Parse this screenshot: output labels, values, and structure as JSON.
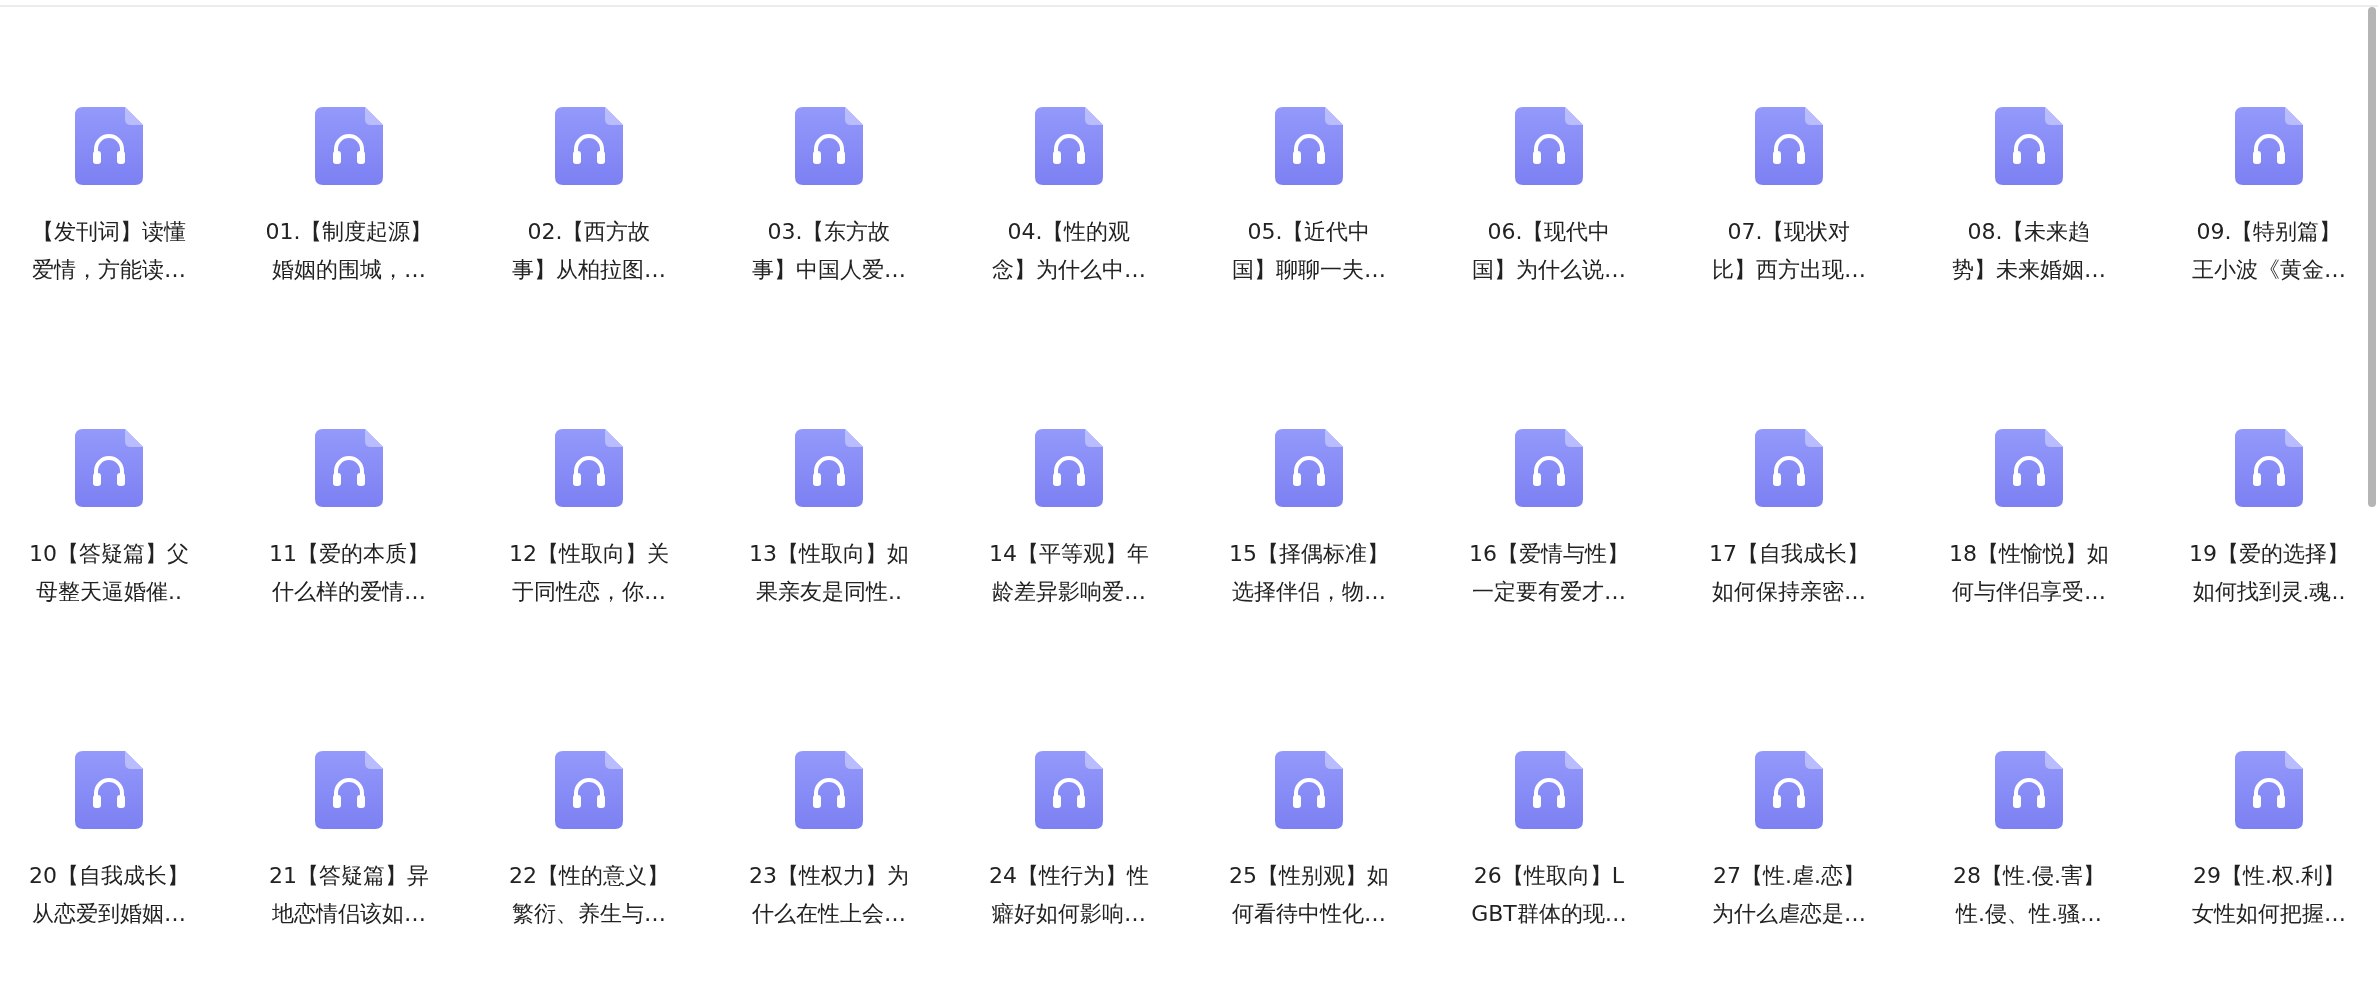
{
  "files": [
    {
      "lines": [
        "【发刊词】读懂",
        "爱情，方能读…"
      ]
    },
    {
      "lines": [
        "01.【制度起源】",
        "婚姻的围城，…"
      ]
    },
    {
      "lines": [
        "02.【西方故",
        "事】从柏拉图…"
      ]
    },
    {
      "lines": [
        "03.【东方故",
        "事】中国人爱…"
      ]
    },
    {
      "lines": [
        "04.【性的观",
        "念】为什么中…"
      ]
    },
    {
      "lines": [
        "05.【近代中",
        "国】聊聊一夫…"
      ]
    },
    {
      "lines": [
        "06.【现代中",
        "国】为什么说…"
      ]
    },
    {
      "lines": [
        "07.【现状对",
        "比】西方出现…"
      ]
    },
    {
      "lines": [
        "08.【未来趋",
        "势】未来婚姻…"
      ]
    },
    {
      "lines": [
        "09.【特别篇】",
        "王小波《黄金…"
      ]
    },
    {
      "lines": [
        "10【答疑篇】父",
        "母整天逼婚催.."
      ]
    },
    {
      "lines": [
        "11【爱的本质】",
        "什么样的爱情…"
      ]
    },
    {
      "lines": [
        "12【性取向】关",
        "于同性恋，你…"
      ]
    },
    {
      "lines": [
        "13【性取向】如",
        "果亲友是同性.."
      ]
    },
    {
      "lines": [
        "14【平等观】年",
        "龄差异影响爱…"
      ]
    },
    {
      "lines": [
        "15【择偶标准】",
        "选择伴侣，物…"
      ]
    },
    {
      "lines": [
        "16【爱情与性】",
        "一定要有爱才…"
      ]
    },
    {
      "lines": [
        "17【自我成长】",
        "如何保持亲密…"
      ]
    },
    {
      "lines": [
        "18【性愉悦】如",
        "何与伴侣享受…"
      ]
    },
    {
      "lines": [
        "19【爱的选择】",
        "如何找到灵.魂.."
      ]
    },
    {
      "lines": [
        "20【自我成长】",
        "从恋爱到婚姻…"
      ]
    },
    {
      "lines": [
        "21【答疑篇】异",
        "地恋情侣该如…"
      ]
    },
    {
      "lines": [
        "22【性的意义】",
        "繁衍、养生与…"
      ]
    },
    {
      "lines": [
        "23【性权力】为",
        "什么在性上会…"
      ]
    },
    {
      "lines": [
        "24【性行为】性",
        "癖好如何影响…"
      ]
    },
    {
      "lines": [
        "25【性别观】如",
        "何看待中性化…"
      ]
    },
    {
      "lines": [
        "26【性取向】L",
        "GBT群体的现…"
      ]
    },
    {
      "lines": [
        "27【性.虐.恋】",
        "为什么虐恋是…"
      ]
    },
    {
      "lines": [
        "28【性.侵.害】",
        "性.侵、性.骚…"
      ]
    },
    {
      "lines": [
        "29【性.权.利】",
        "女性如何把握…"
      ]
    }
  ]
}
